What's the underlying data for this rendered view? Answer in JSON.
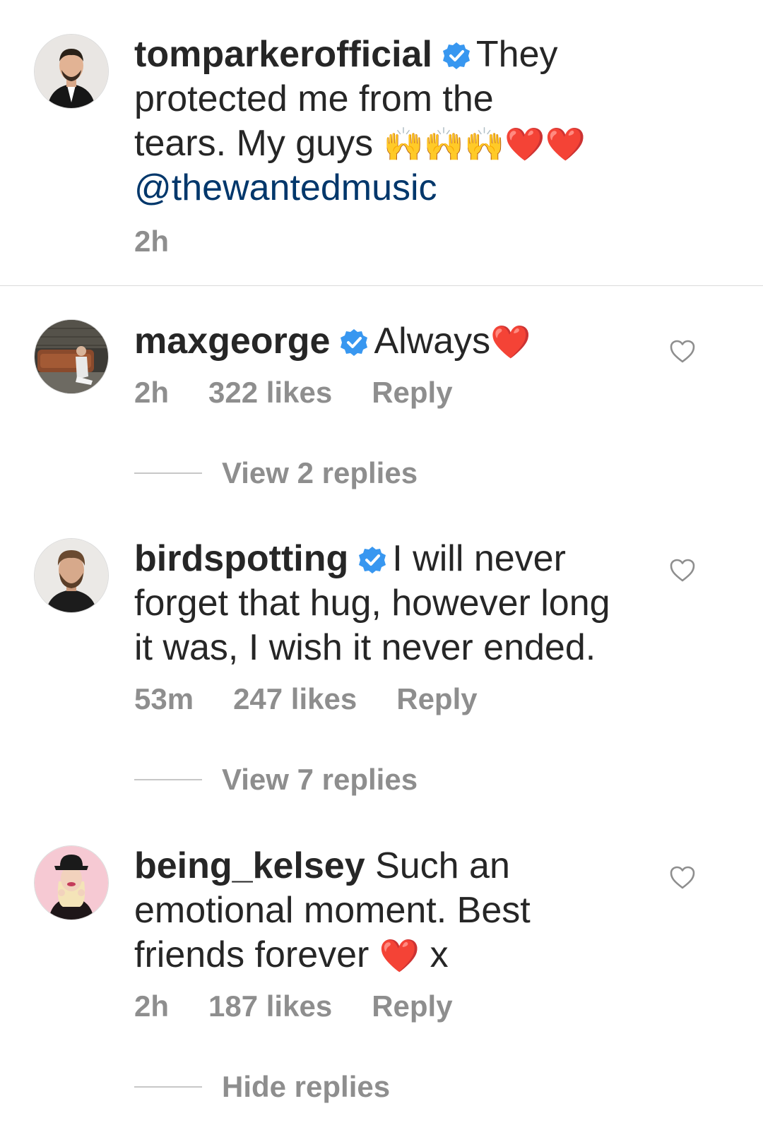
{
  "caption": {
    "username": "tomparkerofficial",
    "verified": true,
    "text_line1": "They",
    "text_line2": "protected me from the",
    "text_line3": "tears. My guys",
    "emojis": "🙌🙌🙌❤️❤️",
    "mention": "@thewantedmusic",
    "time": "2h"
  },
  "comments": [
    {
      "username": "maxgeorge",
      "verified": true,
      "text": "Always",
      "emoji": "❤️",
      "time": "2h",
      "likes": "322 likes",
      "reply_label": "Reply",
      "replies_label": "View 2 replies"
    },
    {
      "username": "birdspotting",
      "verified": true,
      "text_line1": "I will never",
      "text_line2": "forget that hug, however long",
      "text_line3": "it was, I wish it never ended.",
      "time": "53m",
      "likes": "247 likes",
      "reply_label": "Reply",
      "replies_label": "View 7 replies"
    },
    {
      "username": "being_kelsey",
      "verified": false,
      "text_line1": "Such an",
      "text_line2": "emotional moment. Best",
      "text_line3": "friends forever",
      "emoji": "❤️",
      "text_tail": "x",
      "time": "2h",
      "likes": "187 likes",
      "reply_label": "Reply",
      "replies_label": "Hide replies"
    }
  ],
  "colors": {
    "text": "#262626",
    "secondary": "#8e8e8e",
    "mention": "#00376b",
    "verified": "#3897f0",
    "heart": "#e0141e"
  },
  "icons": {
    "verified": "verified-badge-icon",
    "like": "heart-outline-icon"
  }
}
